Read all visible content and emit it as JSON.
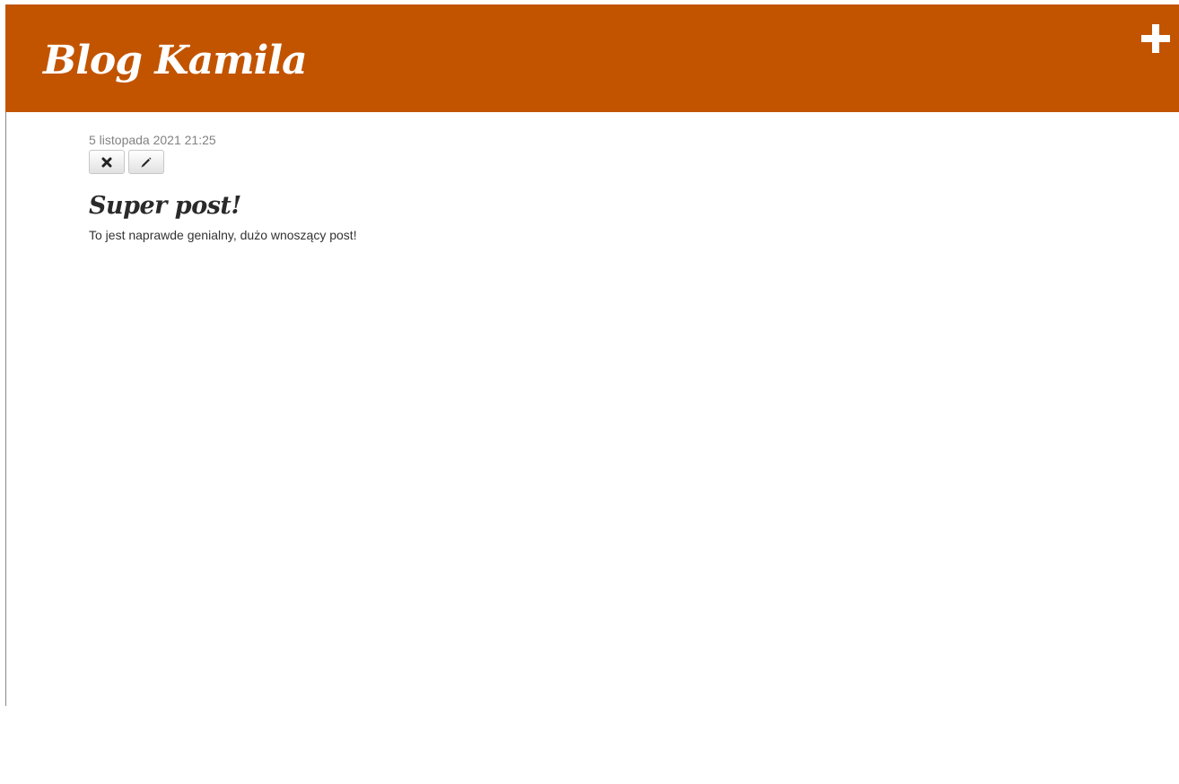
{
  "header": {
    "title": "Blog Kamila",
    "background": "#c25400",
    "add_icon": "plus-icon"
  },
  "post": {
    "date": "5 listopada 2021 21:25",
    "title": "Super post!",
    "body": "To jest naprawde genialny, dużo wnoszący post!",
    "actions": [
      {
        "name": "delete",
        "icon": "remove-icon"
      },
      {
        "name": "edit",
        "icon": "pencil-icon"
      }
    ]
  }
}
